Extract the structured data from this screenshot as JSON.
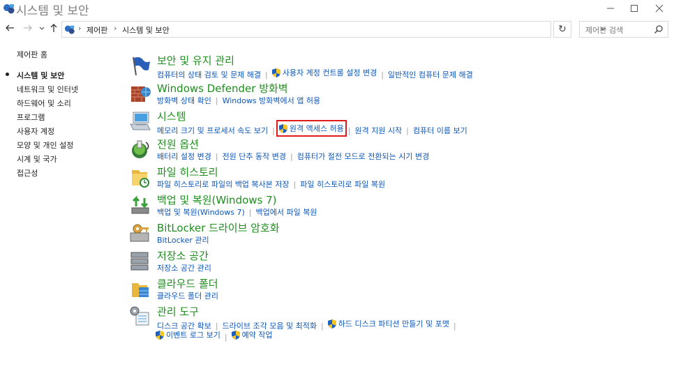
{
  "window": {
    "title": "시스템 및 보안"
  },
  "address": {
    "breadcrumb": [
      "제어판",
      "시스템 및 보안"
    ],
    "search_placeholder": "제어판 검색"
  },
  "left_nav": {
    "home": "제어판 홈",
    "items": [
      {
        "label": "시스템 및 보안",
        "current": true
      },
      {
        "label": "네트워크 및 인터넷"
      },
      {
        "label": "하드웨어 및 소리"
      },
      {
        "label": "프로그램"
      },
      {
        "label": "사용자 계정"
      },
      {
        "label": "모양 및 개인 설정"
      },
      {
        "label": "시계 및 국가"
      },
      {
        "label": "접근성"
      }
    ]
  },
  "categories": [
    {
      "title": "보안 및 유지 관리",
      "icon": "flag-icon",
      "links": [
        {
          "text": "컴퓨터의 상태 검토 및 문제 해결"
        },
        {
          "text": "사용자 계정 컨트롤 설정 변경",
          "shield": true
        },
        {
          "text": "일반적인 컴퓨터 문제 해결"
        }
      ]
    },
    {
      "title": "Windows Defender 방화벽",
      "icon": "firewall-icon",
      "links": [
        {
          "text": "방화벽 상태 확인"
        },
        {
          "text": "Windows 방화벽에서 앱 허용"
        }
      ]
    },
    {
      "title": "시스템",
      "icon": "system-icon",
      "links": [
        {
          "text": "메모리 크기 및 프로세서 속도 보기"
        },
        {
          "text": "원격 액세스 허용",
          "shield": true,
          "highlighted": true
        },
        {
          "text": "원격 지원 시작"
        },
        {
          "text": "컴퓨터 이름 보기"
        }
      ]
    },
    {
      "title": "전원 옵션",
      "icon": "power-icon",
      "links": [
        {
          "text": "배터리 설정 변경"
        },
        {
          "text": "전원 단추 동작 변경"
        },
        {
          "text": "컴퓨터가 절전 모드로 전환되는 시기 변경"
        }
      ]
    },
    {
      "title": "파일 히스토리",
      "icon": "file-history-icon",
      "links": [
        {
          "text": "파일 히스토리로 파일의 백업 복사본 저장"
        },
        {
          "text": "파일 히스토리로 파일 복원"
        }
      ]
    },
    {
      "title": "백업 및 복원(Windows 7)",
      "icon": "backup-icon",
      "links": [
        {
          "text": "백업 및 복원(Windows 7)"
        },
        {
          "text": "백업에서 파일 복원"
        }
      ]
    },
    {
      "title": "BitLocker 드라이브 암호화",
      "icon": "bitlocker-icon",
      "links": [
        {
          "text": "BitLocker 관리"
        }
      ]
    },
    {
      "title": "저장소 공간",
      "icon": "storage-icon",
      "links": [
        {
          "text": "저장소 공간 관리"
        }
      ]
    },
    {
      "title": "클라우드 폴더",
      "icon": "cloud-folder-icon",
      "links": [
        {
          "text": "클라우드 폴더 관리"
        }
      ]
    },
    {
      "title": "관리 도구",
      "icon": "admin-tools-icon",
      "links": [
        {
          "text": "디스크 공간 확보"
        },
        {
          "text": "드라이브 조각 모음 및 최적화"
        },
        {
          "text": "하드 디스크 파티션 만들기 및 포맷",
          "shield": true
        }
      ],
      "links2": [
        {
          "text": "이벤트 로그 보기",
          "shield": true
        },
        {
          "text": "예약 작업",
          "shield": true
        }
      ]
    }
  ],
  "colors": {
    "category_title": "#1e8e1e",
    "link": "#0c56b8",
    "highlight_border": "#e01b1b"
  }
}
